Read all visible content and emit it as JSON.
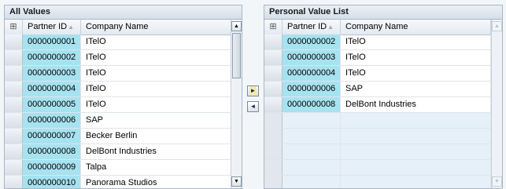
{
  "left": {
    "title": "All Values",
    "columns": {
      "select_icon": "⊞",
      "partner_id": "Partner ID",
      "sort_icon": "▲",
      "company": "Company Name"
    },
    "rows": [
      {
        "id": "0000000001",
        "company": "ITelO"
      },
      {
        "id": "0000000002",
        "company": "ITelO"
      },
      {
        "id": "0000000003",
        "company": "ITelO"
      },
      {
        "id": "0000000004",
        "company": "ITelO"
      },
      {
        "id": "0000000005",
        "company": "ITelO"
      },
      {
        "id": "0000000006",
        "company": "SAP"
      },
      {
        "id": "0000000007",
        "company": "Becker Berlin"
      },
      {
        "id": "0000000008",
        "company": "DelBont Industries"
      },
      {
        "id": "0000000009",
        "company": "Talpa"
      },
      {
        "id": "0000000010",
        "company": "Panorama Studios"
      }
    ]
  },
  "right": {
    "title": "Personal Value List",
    "columns": {
      "select_icon": "⊞",
      "partner_id": "Partner ID",
      "sort_icon": "▲",
      "company": "Company Name"
    },
    "rows": [
      {
        "id": "0000000002",
        "company": "ITelO"
      },
      {
        "id": "0000000003",
        "company": "ITelO"
      },
      {
        "id": "0000000004",
        "company": "ITelO"
      },
      {
        "id": "0000000006",
        "company": "SAP"
      },
      {
        "id": "0000000008",
        "company": "DelBont Industries"
      },
      {
        "id": "",
        "company": ""
      },
      {
        "id": "",
        "company": ""
      },
      {
        "id": "",
        "company": ""
      },
      {
        "id": "",
        "company": ""
      },
      {
        "id": "",
        "company": ""
      }
    ]
  },
  "buttons": {
    "move_right": "►",
    "move_left": "◄"
  },
  "scroll": {
    "up": "▲",
    "down": "▼"
  }
}
